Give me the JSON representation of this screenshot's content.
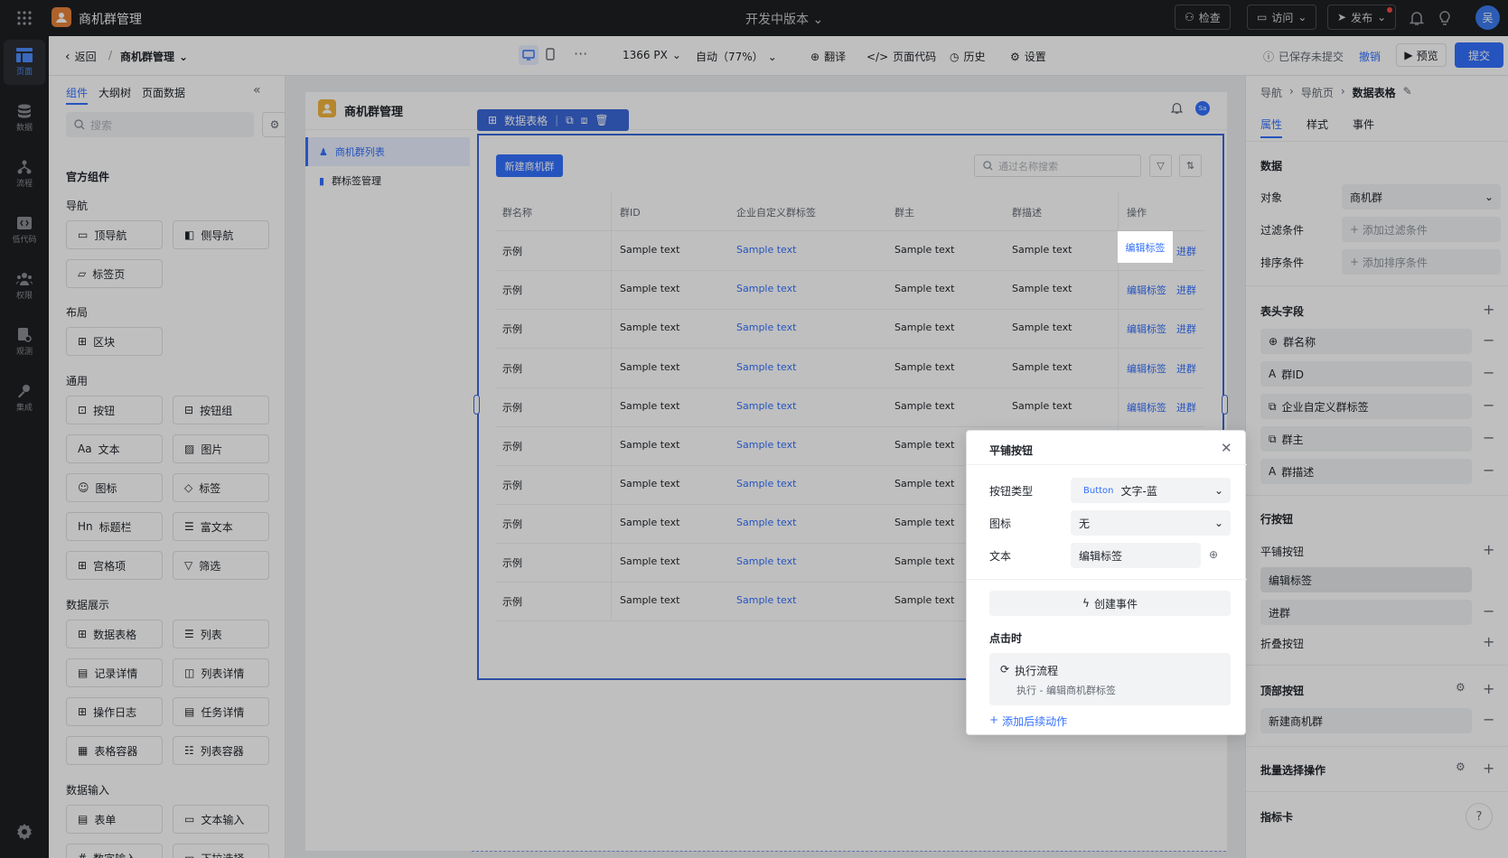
{
  "topbar": {
    "app_title": "商机群管理",
    "version": "开发中版本",
    "check": "检查",
    "visit": "访问",
    "publish": "发布",
    "avatar": "吴"
  },
  "rail": [
    "页面",
    "数据",
    "流程",
    "低代码",
    "权限",
    "观测",
    "集成"
  ],
  "toolbar": {
    "back": "返回",
    "breadcrumb": "商机群管理",
    "width": "1366 PX",
    "zoom": "自动（77%）",
    "translate": "翻译",
    "page_code": "页面代码",
    "history": "历史",
    "settings": "设置",
    "saved": "已保存未提交",
    "undo": "撤销",
    "preview": "预览",
    "submit": "提交"
  },
  "left_panel": {
    "tabs": [
      "组件",
      "大纲树",
      "页面数据"
    ],
    "search_placeholder": "搜索",
    "section": "官方组件",
    "groups": {
      "nav": "导航",
      "layout": "布局",
      "common": "通用",
      "display": "数据展示",
      "input": "数据输入"
    },
    "components": {
      "top_nav": "顶导航",
      "side_nav": "侧导航",
      "tabs": "标签页",
      "block": "区块",
      "button": "按钮",
      "button_group": "按钮组",
      "text": "文本",
      "image": "图片",
      "icon": "图标",
      "tag": "标签",
      "title_bar": "标题栏",
      "rich_text": "富文本",
      "grid_item": "宫格项",
      "filter": "筛选",
      "data_table": "数据表格",
      "list": "列表",
      "record_detail": "记录详情",
      "list_detail": "列表详情",
      "op_log": "操作日志",
      "task_detail": "任务详情",
      "table_container": "表格容器",
      "list_container": "列表容器",
      "form": "表单",
      "text_input": "文本输入",
      "number_input": "数字输入",
      "dropdown": "下拉选择"
    }
  },
  "canvas": {
    "app_title": "商机群管理",
    "avatar": "Sa",
    "nav": [
      "商机群列表",
      "群标签管理"
    ],
    "selection_label": "数据表格",
    "new_button": "新建商机群",
    "search_placeholder": "通过名称搜索",
    "columns": [
      "群名称",
      "群ID",
      "企业自定义群标签",
      "群主",
      "群描述",
      "操作"
    ],
    "row": {
      "name": "示例",
      "id": "Sample text",
      "tag": "Sample text",
      "owner": "Sample text",
      "desc": "Sample text",
      "edit": "编辑标签",
      "join": "进群"
    }
  },
  "right_panel": {
    "breadcrumb": [
      "导航",
      "导航页",
      "数据表格"
    ],
    "tabs": [
      "属性",
      "样式",
      "事件"
    ],
    "data_section": "数据",
    "object_label": "对象",
    "object_value": "商机群",
    "filter_label": "过滤条件",
    "filter_value": "添加过滤条件",
    "sort_label": "排序条件",
    "sort_value": "添加排序条件",
    "header_section": "表头字段",
    "fields": [
      "群名称",
      "群ID",
      "企业自定义群标签",
      "群主",
      "群描述"
    ],
    "row_btn_section": "行按钮",
    "tile_buttons": "平铺按钮",
    "tile_items": [
      "编辑标签",
      "进群"
    ],
    "fold_buttons": "折叠按钮",
    "top_buttons": "顶部按钮",
    "top_items": [
      "新建商机群"
    ],
    "batch": "批量选择操作",
    "kpi": "指标卡"
  },
  "popup": {
    "title": "平铺按钮",
    "type_label": "按钮类型",
    "type_tag": "Button",
    "type_value": "文字-蓝",
    "icon_label": "图标",
    "icon_value": "无",
    "text_label": "文本",
    "text_value": "编辑标签",
    "create_event": "创建事件",
    "on_click": "点击时",
    "flow_title": "执行流程",
    "flow_desc": "执行 - 编辑商机群标签",
    "add_action": "添加后续动作"
  },
  "colors": {
    "accent": "#3370ff",
    "selection": "#3a67d9",
    "topbar": "#1e1f22"
  }
}
